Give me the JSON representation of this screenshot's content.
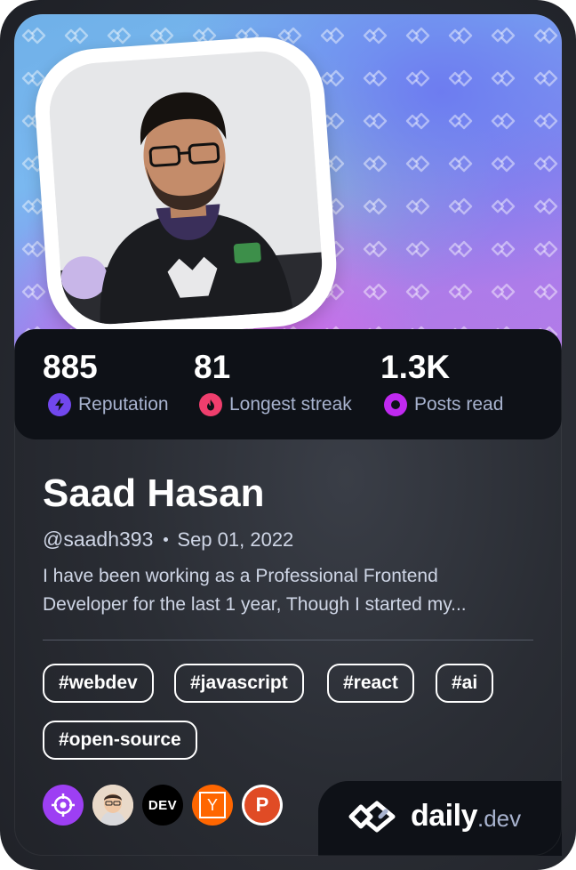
{
  "profile": {
    "name": "Saad Hasan",
    "handle": "@saadh393",
    "joined": "Sep 01, 2022",
    "bio_line1": "I have been working as a Professional Frontend",
    "bio_line2": "Developer for the last 1 year, Though I started my..."
  },
  "stats": [
    {
      "value": "885",
      "label": "Reputation",
      "icon": "bolt-icon",
      "color": "#7147ed"
    },
    {
      "value": "81",
      "label": "Longest streak",
      "icon": "flame-icon",
      "color": "#ef3e6d"
    },
    {
      "value": "1.3K",
      "label": "Posts read",
      "icon": "ring-icon",
      "color": "#c029f0"
    }
  ],
  "tags": [
    "#webdev",
    "#javascript",
    "#react",
    "#ai",
    "#open-source"
  ],
  "badges": [
    {
      "icon": "crosshair-icon",
      "color": "#9d3ff3"
    },
    {
      "icon": "avatar-icon",
      "color": "#e8d7c8"
    },
    {
      "icon": "dev-icon",
      "label": "DEV",
      "color": "#000000"
    },
    {
      "icon": "y-icon",
      "label": "Y",
      "color": "#ff6600"
    },
    {
      "icon": "p-icon",
      "label": "P",
      "color": "#e04b25"
    }
  ],
  "brand": {
    "daily": "daily",
    "dev": ".dev"
  },
  "colors": {
    "card_bg": "#2a2d34",
    "stats_bg": "#0e1117",
    "tag_border": "#ffffff",
    "muted_text": "#a8b3cf"
  }
}
